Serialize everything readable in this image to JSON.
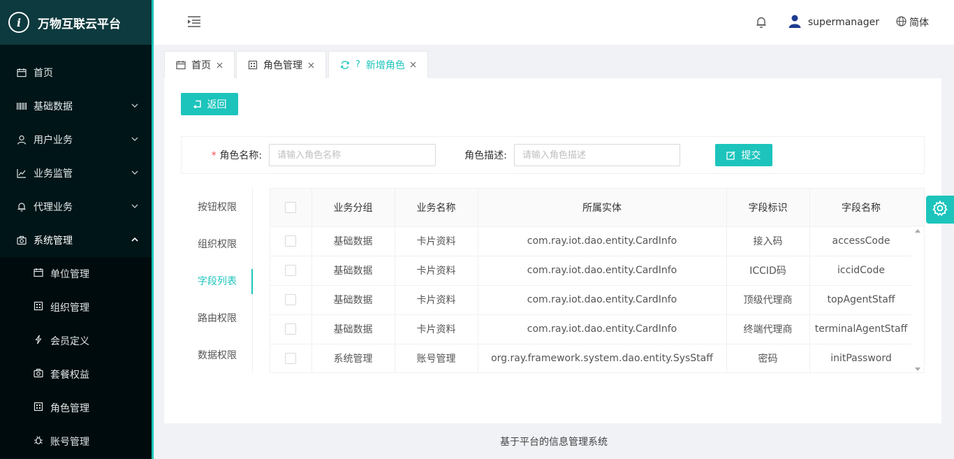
{
  "app": {
    "title": "万物互联云平台",
    "logo_letter": "i"
  },
  "colors": {
    "accent": "#1cc4bc",
    "sidebar_bg": "#001518",
    "logo_bg": "#0d3a3e",
    "submenu_bg": "#000b0d"
  },
  "sidebar": {
    "items": [
      {
        "label": "首页",
        "icon": "calendar-icon"
      },
      {
        "label": "基础数据",
        "icon": "barcode-icon"
      },
      {
        "label": "用户业务",
        "icon": "user-icon"
      },
      {
        "label": "业务监管",
        "icon": "line-chart-icon"
      },
      {
        "label": "代理业务",
        "icon": "bell-icon"
      },
      {
        "label": "系统管理",
        "icon": "camera-icon"
      }
    ],
    "sub_items": [
      {
        "label": "单位管理",
        "icon": "calendar-icon"
      },
      {
        "label": "组织管理",
        "icon": "grid-icon"
      },
      {
        "label": "会员定义",
        "icon": "lightning-icon"
      },
      {
        "label": "套餐权益",
        "icon": "camera-icon"
      },
      {
        "label": "角色管理",
        "icon": "grid-icon"
      },
      {
        "label": "账号管理",
        "icon": "bug-icon"
      }
    ]
  },
  "header": {
    "user_name": "supermanager",
    "language": "简体"
  },
  "tabs": [
    {
      "label": "首页"
    },
    {
      "label": "角色管理"
    },
    {
      "label": "新增角色",
      "prefix": "?"
    }
  ],
  "actions": {
    "back_label": "返回",
    "submit_label": "提交"
  },
  "form": {
    "role_name_label": "角色名称:",
    "role_name_required": "*",
    "role_name_placeholder": "请输入角色名称",
    "role_desc_label": "角色描述:",
    "role_desc_placeholder": "请输入角色描述"
  },
  "permission_tabs": [
    {
      "label": "按钮权限"
    },
    {
      "label": "组织权限"
    },
    {
      "label": "字段列表",
      "active": true
    },
    {
      "label": "路由权限"
    },
    {
      "label": "数据权限"
    }
  ],
  "table": {
    "columns": [
      "业务分组",
      "业务名称",
      "所属实体",
      "字段标识",
      "字段名称"
    ],
    "rows": [
      [
        "基础数据",
        "卡片资料",
        "com.ray.iot.dao.entity.CardInfo",
        "接入码",
        "accessCode"
      ],
      [
        "基础数据",
        "卡片资料",
        "com.ray.iot.dao.entity.CardInfo",
        "ICCID码",
        "iccidCode"
      ],
      [
        "基础数据",
        "卡片资料",
        "com.ray.iot.dao.entity.CardInfo",
        "顶级代理商",
        "topAgentStaff"
      ],
      [
        "基础数据",
        "卡片资料",
        "com.ray.iot.dao.entity.CardInfo",
        "终端代理商",
        "terminalAgentStaff"
      ],
      [
        "系统管理",
        "账号管理",
        "org.ray.framework.system.dao.entity.SysStaff",
        "密码",
        "initPassword"
      ]
    ]
  },
  "footer": {
    "text": "基于平台的信息管理系统"
  }
}
